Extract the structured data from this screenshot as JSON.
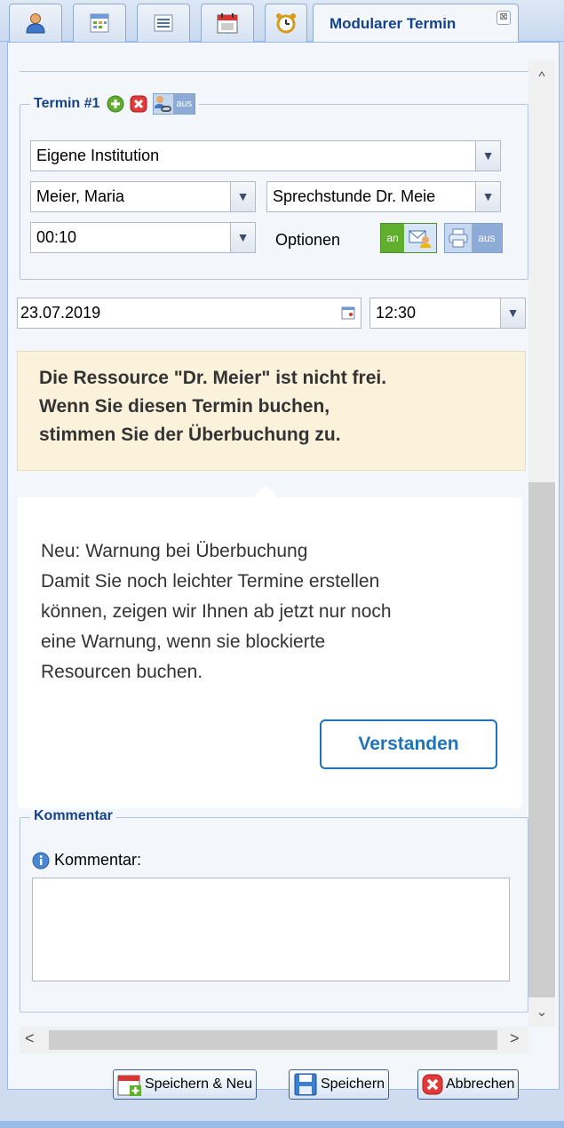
{
  "tabs": {
    "icons": [
      "user-icon",
      "calendar-grid-icon",
      "list-icon",
      "calendar-clock-icon",
      "alarm-clock-icon"
    ],
    "active_title": "Modularer Termin",
    "close_glyph": "⊠"
  },
  "termin": {
    "legend": "Termin #1",
    "toggle_label": "aus",
    "institution": "Eigene Institution",
    "person": "Meier, Maria",
    "resource": "Sprechstunde Dr. Meie",
    "duration": "00:10",
    "options_label": "Optionen",
    "notify_toggle_label": "an",
    "print_toggle_label": "aus"
  },
  "datetime": {
    "date": "23.07.2019",
    "time": "12:30"
  },
  "warning": {
    "lines": [
      "Die Ressource \"Dr. Meier\" ist nicht frei.",
      "Wenn Sie diesen Termin buchen,",
      "stimmen Sie der Überbuchung zu."
    ]
  },
  "popup": {
    "lines": [
      "Neu: Warnung bei Überbuchung",
      "Damit Sie noch leichter Termine erstellen",
      "können, zeigen wir Ihnen ab jetzt nur noch",
      "eine Warnung, wenn sie blockierte",
      "Resourcen buchen."
    ],
    "button_label": "Verstanden"
  },
  "kommentar": {
    "legend": "Kommentar",
    "field_label": "Kommentar:",
    "value": ""
  },
  "footer": {
    "save_new_label": "Speichern & Neu",
    "save_label": "Speichern",
    "cancel_label": "Abbrechen"
  },
  "colors": {
    "accent": "#15428b",
    "warning_bg": "#fbf2dc",
    "button_blue": "#1e73be",
    "toggle_green": "#5fae2e"
  }
}
